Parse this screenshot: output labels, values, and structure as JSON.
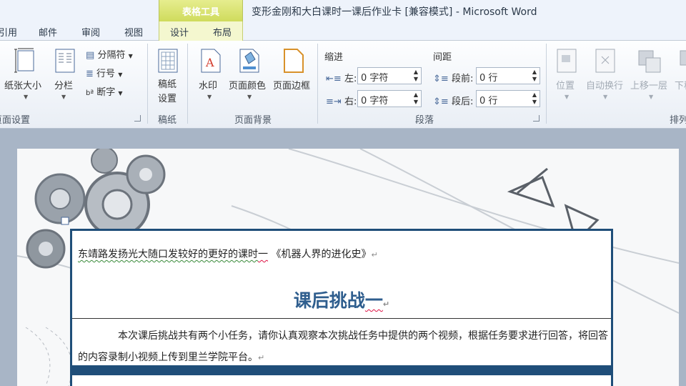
{
  "titlebar": {
    "context_group": "表格工具",
    "window_title": "变形金刚和大白课时一课后作业卡 [兼容模式] - Microsoft Word"
  },
  "tabs": [
    {
      "label": "引用"
    },
    {
      "label": "邮件"
    },
    {
      "label": "审阅"
    },
    {
      "label": "视图"
    },
    {
      "label": "设计"
    },
    {
      "label": "布局"
    }
  ],
  "ribbon": {
    "page_setup": {
      "paper_size": "纸张大小",
      "columns": "分栏",
      "breaks": "分隔符",
      "line_numbers": "行号",
      "hyphenation": "断字",
      "group_label": "页面设置"
    },
    "manuscript": {
      "button": "稿纸设置",
      "group_label": "稿纸"
    },
    "page_background": {
      "watermark": "水印",
      "page_color": "页面颜色",
      "page_borders": "页面边框",
      "group_label": "页面背景"
    },
    "paragraph": {
      "indent_head": "缩进",
      "spacing_head": "间距",
      "left_label": "左:",
      "left_value": "0 字符",
      "right_label": "右:",
      "right_value": "0 字符",
      "before_label": "段前:",
      "before_value": "0 行",
      "after_label": "段后:",
      "after_value": "0 行",
      "group_label": "段落"
    },
    "arrange": {
      "position": "位置",
      "wrap_text": "自动换行",
      "bring_forward": "上移一层",
      "send_backward": "下移",
      "group_label": "排列"
    }
  },
  "document": {
    "line1_a": "东靖路发扬光大随口发较好的更好的课时",
    "line1_b": "一",
    "line1_c": " 《机器人界的进化史》",
    "heading_a": "课后挑战",
    "heading_b": "一",
    "para": "本次课后挑战共有两个小任务，请你认真观察本次挑战任务中提供的两个视频，根据任务要求进行回答，将回答的内容录制小视频上传到里兰学院平台。",
    "pilcrow": "↵"
  },
  "colors": {
    "accent_blue": "#1f4e79",
    "heading_blue": "#2f5e8e",
    "context_tab": "#cfdb5c"
  }
}
